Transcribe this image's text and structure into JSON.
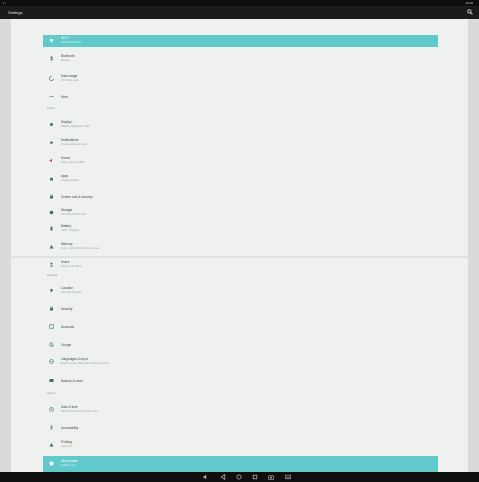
{
  "status_bar": {
    "left": "▪ ▪",
    "right": "12:00"
  },
  "app_bar": {
    "title": "Settings"
  },
  "rows": [
    {
      "title": "Wi-Fi",
      "subtitle": "Connected to Wi-Fi",
      "active": true
    },
    {
      "title": "Bluetooth",
      "subtitle": "Disabled",
      "active": false
    },
    {
      "title": "Data usage",
      "subtitle": "0 B of data used",
      "active": false
    },
    {
      "title": "More",
      "subtitle": "",
      "active": false
    },
    {
      "title": "Display",
      "subtitle": "Adaptive brightness is OFF",
      "active": false
    },
    {
      "title": "Notifications",
      "subtitle": "All apps allowed to send",
      "active": false
    },
    {
      "title": "Sound",
      "subtitle": "Ringer volume at 80%",
      "active": false
    },
    {
      "title": "Apps",
      "subtitle": "22 apps installed",
      "active": false
    },
    {
      "title": "Screen lock & security",
      "subtitle": "",
      "active": false
    },
    {
      "title": "Storage",
      "subtitle": "3.10 GB of 16 GB used",
      "active": false
    },
    {
      "title": "Battery",
      "subtitle": "100% - Charging",
      "active": false
    },
    {
      "title": "Memory",
      "subtitle": "Avg 1.1 GB of 2.0 GB memory used",
      "active": false
    },
    {
      "title": "Users",
      "subtitle": "Signed in as Owner",
      "active": false
    },
    {
      "title": "Location",
      "subtitle": "ON / High accuracy",
      "active": false
    },
    {
      "title": "Security",
      "subtitle": "",
      "active": false
    },
    {
      "title": "Accounts",
      "subtitle": "",
      "active": false
    },
    {
      "title": "Google",
      "subtitle": "",
      "active": false
    },
    {
      "title": "Languages & input",
      "subtitle": "English (United States) and Android keyboard",
      "active": false
    },
    {
      "title": "Backup & reset",
      "subtitle": "",
      "active": false
    },
    {
      "title": "Date & time",
      "subtitle": "GMT+00:00 Greenwich Mean Time",
      "active": false
    },
    {
      "title": "Accessibility",
      "subtitle": "",
      "active": false
    },
    {
      "title": "Printing",
      "subtitle": "0 print jobs",
      "active": false
    },
    {
      "title": "About tablet",
      "subtitle": "Android 7.1.2",
      "active": true
    }
  ],
  "section_headers": [
    "Device",
    "Personal",
    "System"
  ],
  "nav_bar": [
    "volume-down",
    "back",
    "home",
    "recents",
    "camera",
    "keyboard"
  ],
  "colors": {
    "accent": "#62c9cb",
    "icon": "#3f6e6e"
  }
}
